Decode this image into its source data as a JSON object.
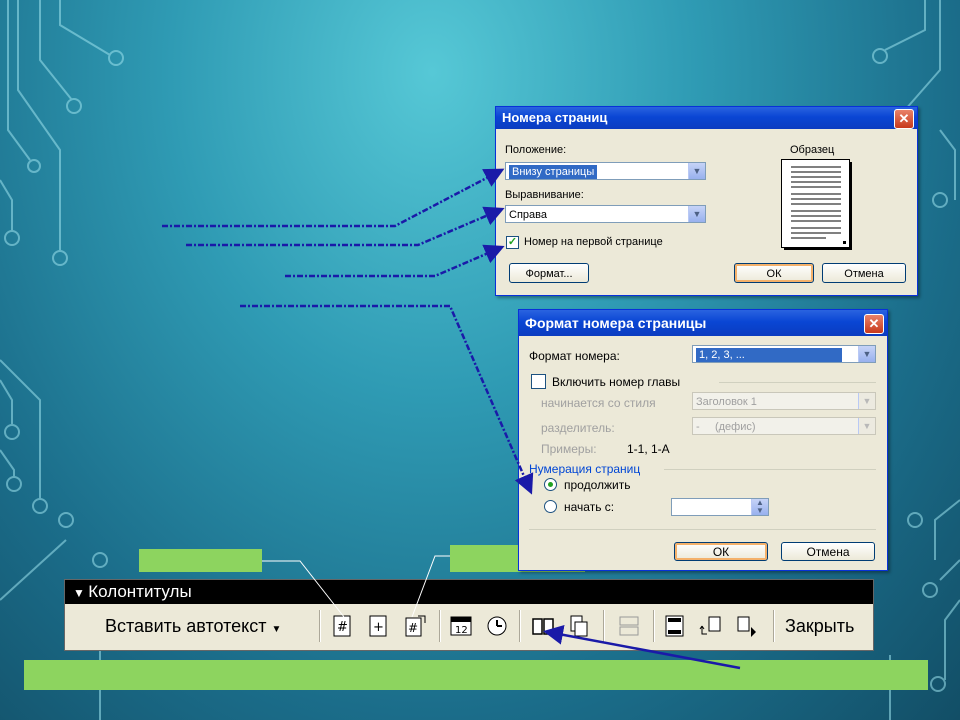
{
  "page_number_dialog": {
    "title": "Номера страниц",
    "position_label": "Положение:",
    "position_value": "Внизу страницы",
    "alignment_label": "Выравнивание:",
    "alignment_value": "Справа",
    "first_page_checkbox_label": "Номер на первой странице",
    "first_page_checked": true,
    "preview_label": "Образец",
    "format_button": "Формат...",
    "ok_button": "ОК",
    "cancel_button": "Отмена"
  },
  "format_dialog": {
    "title": "Формат номера страницы",
    "number_format_label": "Формат номера:",
    "number_format_value": "1, 2, 3, ...",
    "include_chapter_label": "Включить номер главы",
    "include_chapter_checked": false,
    "style_label": "начинается со стиля",
    "style_value": "Заголовок 1",
    "separator_label": "разделитель:",
    "separator_value": "-     (дефис)",
    "examples_label": "Примеры:",
    "examples_value": "1-1, 1-А",
    "numbering_group_label": "Нумерация страниц",
    "continue_label": "продолжить",
    "start_at_label": "начать с:",
    "start_at_value": "",
    "ok_button": "ОК",
    "cancel_button": "Отмена"
  },
  "toolbar": {
    "title": "Колонтитулы",
    "insert_autotext_label": "Вставить автотекст",
    "close_label": "Закрыть",
    "icons": [
      "page-number-icon",
      "page-count-icon",
      "format-page-number-icon",
      "date-icon",
      "time-icon",
      "page-setup-icon",
      "show-document-icon",
      "same-as-previous-icon",
      "switch-header-footer-icon",
      "show-previous-icon",
      "show-next-icon"
    ]
  },
  "colors": {
    "accent_green": "#8dd45f",
    "arrow_blue": "#1a1aa8",
    "xp_title_blue": "#0a46d4"
  }
}
